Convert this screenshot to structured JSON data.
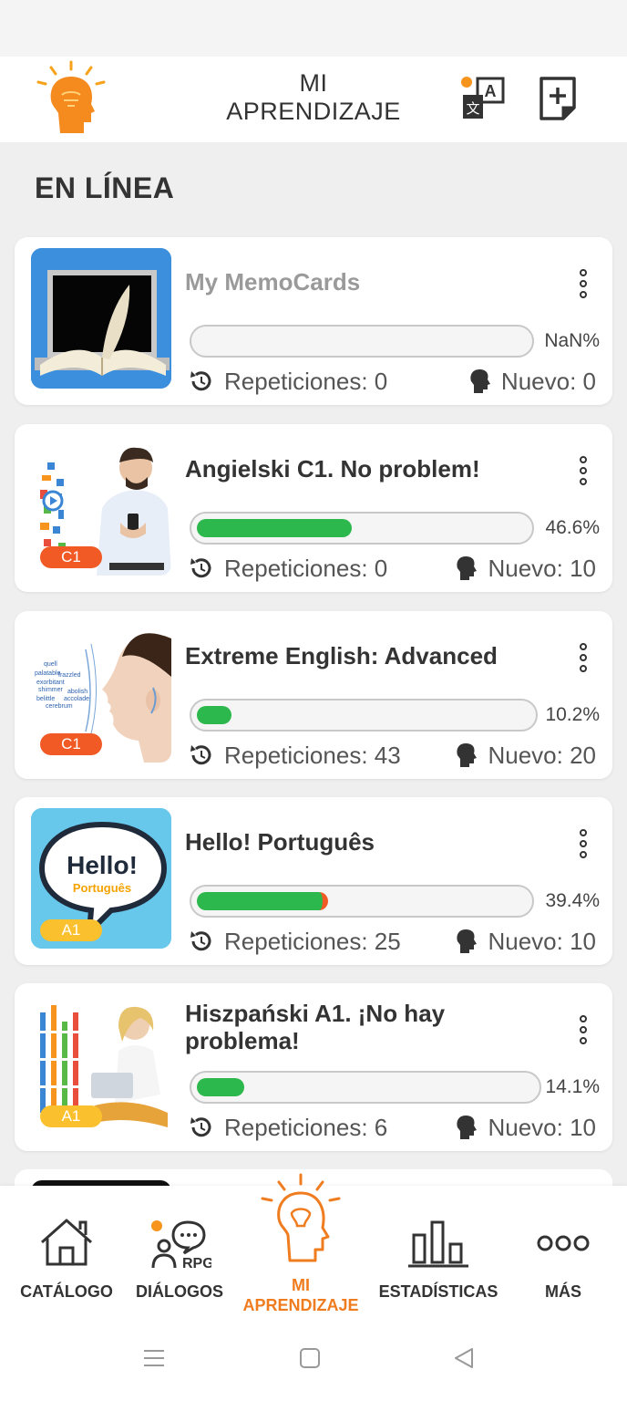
{
  "header": {
    "title_line1": "MI",
    "title_line2": "APRENDIZAJE"
  },
  "section_title": "EN LÍNEA",
  "courses": [
    {
      "title": "My MemoCards",
      "badge": "",
      "progress_percent": 0,
      "percent_label": "NaN%",
      "repetitions": "Repeticiones: 0",
      "new": "Nuevo: 0"
    },
    {
      "title": "Angielski C1. No problem!",
      "badge": "C1",
      "progress_percent": 46.6,
      "percent_label": "46.6%",
      "repetitions": "Repeticiones: 0",
      "new": "Nuevo: 10"
    },
    {
      "title": "Extreme English: Advanced",
      "badge": "C1",
      "progress_percent": 10.2,
      "percent_label": "10.2%",
      "repetitions": "Repeticiones: 43",
      "new": "Nuevo: 20"
    },
    {
      "title": "Hello! Português",
      "badge": "A1",
      "progress_percent": 39.4,
      "percent_label": "39.4%",
      "repetitions": "Repeticiones: 25",
      "new": "Nuevo: 10",
      "thumb_text1": "Hello!",
      "thumb_text2": "Português"
    },
    {
      "title": "Hiszpański A1. ¡No hay problema!",
      "badge": "A1",
      "progress_percent": 14.1,
      "percent_label": "14.1%",
      "repetitions": "Repeticiones: 6",
      "new": "Nuevo: 10"
    }
  ],
  "nav": {
    "catalog": "CATÁLOGO",
    "dialogs": "DIÁLOGOS",
    "dialogs_icon_text": "RPG",
    "learning_line1": "MI",
    "learning_line2": "APRENDIZAJE",
    "stats": "ESTADÍSTICAS",
    "more": "MÁS"
  },
  "colors": {
    "accent_orange": "#f07c20",
    "progress_green": "#2db84d",
    "badge_c1": "#f15a24",
    "badge_a1": "#fbc02d"
  },
  "icons": [
    "bulb-head-logo-icon",
    "translate-icon",
    "add-note-icon",
    "kebab-menu-icon",
    "repeat-icon",
    "head-silhouette-icon",
    "home-icon",
    "chat-rpg-icon",
    "bulb-head-icon",
    "bar-chart-icon",
    "more-dots-icon"
  ]
}
